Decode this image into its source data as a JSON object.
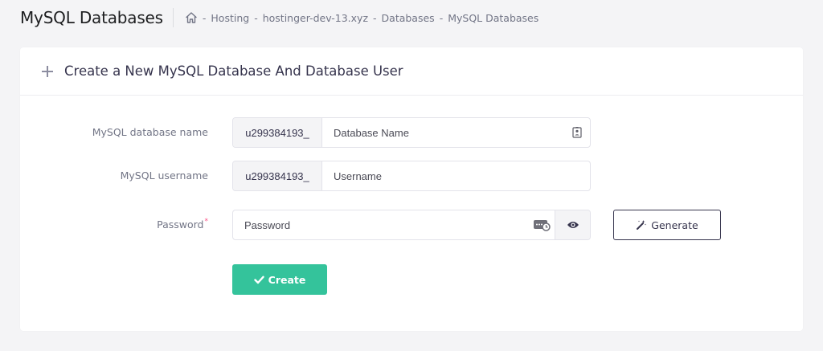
{
  "header": {
    "title": "MySQL Databases",
    "breadcrumb": [
      "Hosting",
      "hostinger-dev-13.xyz",
      "Databases",
      "MySQL Databases"
    ],
    "separator": "-"
  },
  "card": {
    "title": "Create a New MySQL Database And Database User"
  },
  "form": {
    "db_name": {
      "label": "MySQL database name",
      "prefix": "u299384193_",
      "placeholder": "Database Name",
      "value": ""
    },
    "username": {
      "label": "MySQL username",
      "prefix": "u299384193_",
      "placeholder": "Username",
      "value": ""
    },
    "password": {
      "label": "Password",
      "required_mark": "*",
      "placeholder": "Password",
      "value": ""
    },
    "generate_label": "Generate",
    "create_label": "Create"
  },
  "colors": {
    "accent_green": "#34c39b",
    "required_red": "#fc5185",
    "text_dark": "#36344d",
    "text_muted": "#727586"
  },
  "icons": {
    "home": "home-icon",
    "plus": "plus-icon",
    "contact_card": "contact-card-icon",
    "password_manager": "password-manager-icon",
    "eye": "eye-icon",
    "magic_wand": "magic-wand-icon",
    "check": "check-icon"
  }
}
